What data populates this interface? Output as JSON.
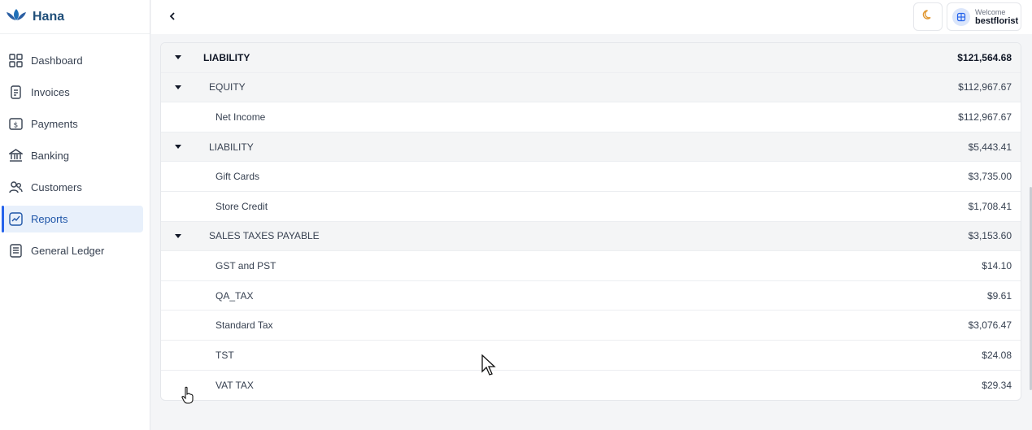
{
  "app": {
    "name": "Hana",
    "brand_color": "#1f4e79"
  },
  "sidebar": {
    "items": [
      {
        "label": "Dashboard",
        "icon": "dashboard-icon"
      },
      {
        "label": "Invoices",
        "icon": "invoice-icon"
      },
      {
        "label": "Payments",
        "icon": "payments-icon"
      },
      {
        "label": "Banking",
        "icon": "bank-icon"
      },
      {
        "label": "Customers",
        "icon": "customers-icon"
      },
      {
        "label": "Reports",
        "icon": "reports-icon",
        "active": true
      },
      {
        "label": "General Ledger",
        "icon": "ledger-icon"
      }
    ]
  },
  "header": {
    "back_icon": "chevron-left-icon",
    "theme_icon": "moon-icon",
    "welcome": "Welcome",
    "username": "bestflorist"
  },
  "report": {
    "rows": [
      {
        "label": "LIABILITY",
        "amount": "$121,564.68"
      },
      {
        "label": "EQUITY",
        "amount": "$112,967.67"
      },
      {
        "label": "Net Income",
        "amount": "$112,967.67"
      },
      {
        "label": "LIABILITY",
        "amount": "$5,443.41"
      },
      {
        "label": "Gift Cards",
        "amount": "$3,735.00"
      },
      {
        "label": "Store Credit",
        "amount": "$1,708.41"
      },
      {
        "label": "SALES TAXES PAYABLE",
        "amount": "$3,153.60"
      },
      {
        "label": "GST and PST",
        "amount": "$14.10"
      },
      {
        "label": "QA_TAX",
        "amount": "$9.61"
      },
      {
        "label": "Standard Tax",
        "amount": "$3,076.47"
      },
      {
        "label": "TST",
        "amount": "$24.08"
      },
      {
        "label": "VAT TAX",
        "amount": "$29.34"
      }
    ]
  },
  "colors": {
    "accent": "#2563eb",
    "active_bg": "#e8f0fb",
    "group_bg": "#f4f5f6",
    "theme_icon": "#e0962f"
  }
}
